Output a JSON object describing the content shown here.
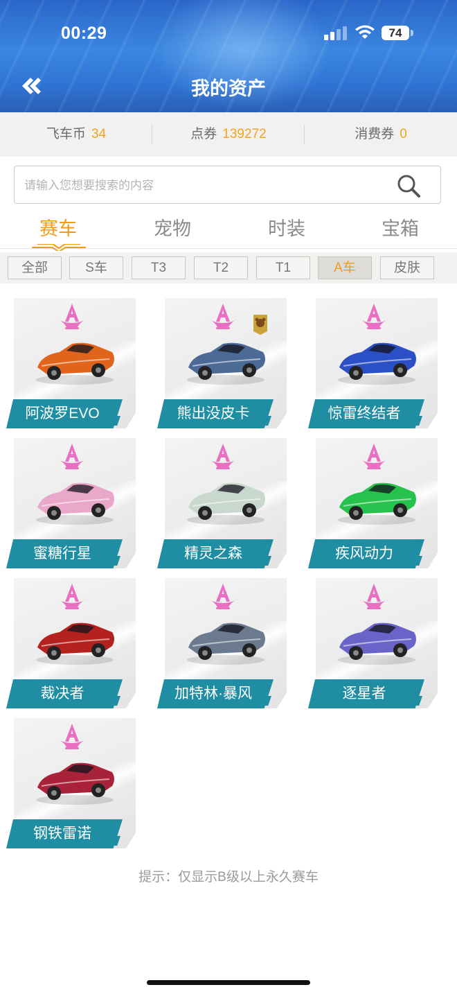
{
  "status_bar": {
    "time": "00:29",
    "battery": "74"
  },
  "header": {
    "title": "我的资产"
  },
  "currencies": [
    {
      "label": "飞车币",
      "value": "34"
    },
    {
      "label": "点券",
      "value": "139272"
    },
    {
      "label": "消费券",
      "value": "0"
    }
  ],
  "search": {
    "placeholder": "请输入您想要搜索的内容"
  },
  "tabs": [
    "赛车",
    "宠物",
    "时装",
    "宝箱"
  ],
  "active_tab": "赛车",
  "filters": [
    "全部",
    "S车",
    "T3",
    "T2",
    "T1",
    "A车",
    "皮肤"
  ],
  "active_filter": "A车",
  "cars": [
    {
      "name": "阿波罗EVO",
      "rank": "A",
      "color": "#e0641c"
    },
    {
      "name": "熊出没皮卡",
      "rank": "A",
      "color": "#4c6a96",
      "badge": true
    },
    {
      "name": "惊雷终结者",
      "rank": "A",
      "color": "#2b4fc4"
    },
    {
      "name": "蜜糖行星",
      "rank": "A",
      "color": "#e9a7c9"
    },
    {
      "name": "精灵之森",
      "rank": "A",
      "color": "#c8d8cf"
    },
    {
      "name": "疾风动力",
      "rank": "A",
      "color": "#27c24d"
    },
    {
      "name": "裁决者",
      "rank": "A",
      "color": "#b3221e"
    },
    {
      "name": "加特林·暴风",
      "rank": "A",
      "color": "#6c7a90"
    },
    {
      "name": "逐星者",
      "rank": "A",
      "color": "#6b64c8"
    },
    {
      "name": "钢铁雷诺",
      "rank": "A",
      "color": "#a8223a"
    }
  ],
  "hint": "提示：仅显示B级以上永久赛车",
  "colors": {
    "accent": "#f39a1b",
    "plate": "#1f8ea3",
    "rank_badge": "#e86fc1"
  }
}
